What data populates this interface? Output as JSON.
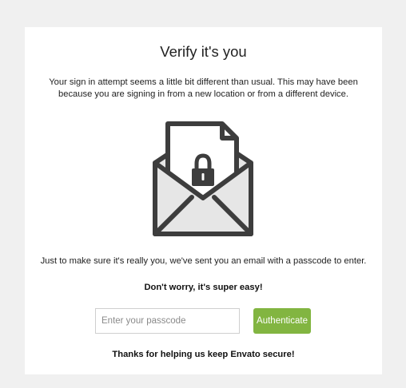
{
  "title": "Verify it's you",
  "intro": "Your sign in attempt seems a little bit different than usual. This may have been because you are signing in from a new location or from a different device.",
  "illustration_icon": "envelope-with-lock-icon",
  "note": "Just to make sure it's really you, we've sent you an email with a passcode to enter.",
  "note_bold": "Don't worry, it's super easy!",
  "form": {
    "passcode_placeholder": "Enter your passcode",
    "passcode_value": "",
    "authenticate_label": "Authenticate"
  },
  "footer": "Thanks for helping us keep Envato secure!",
  "colors": {
    "background": "#f0f0f0",
    "card": "#ffffff",
    "button": "#82b541",
    "icon_stroke": "#3d3d3d",
    "icon_fill": "#e6e6e6"
  }
}
